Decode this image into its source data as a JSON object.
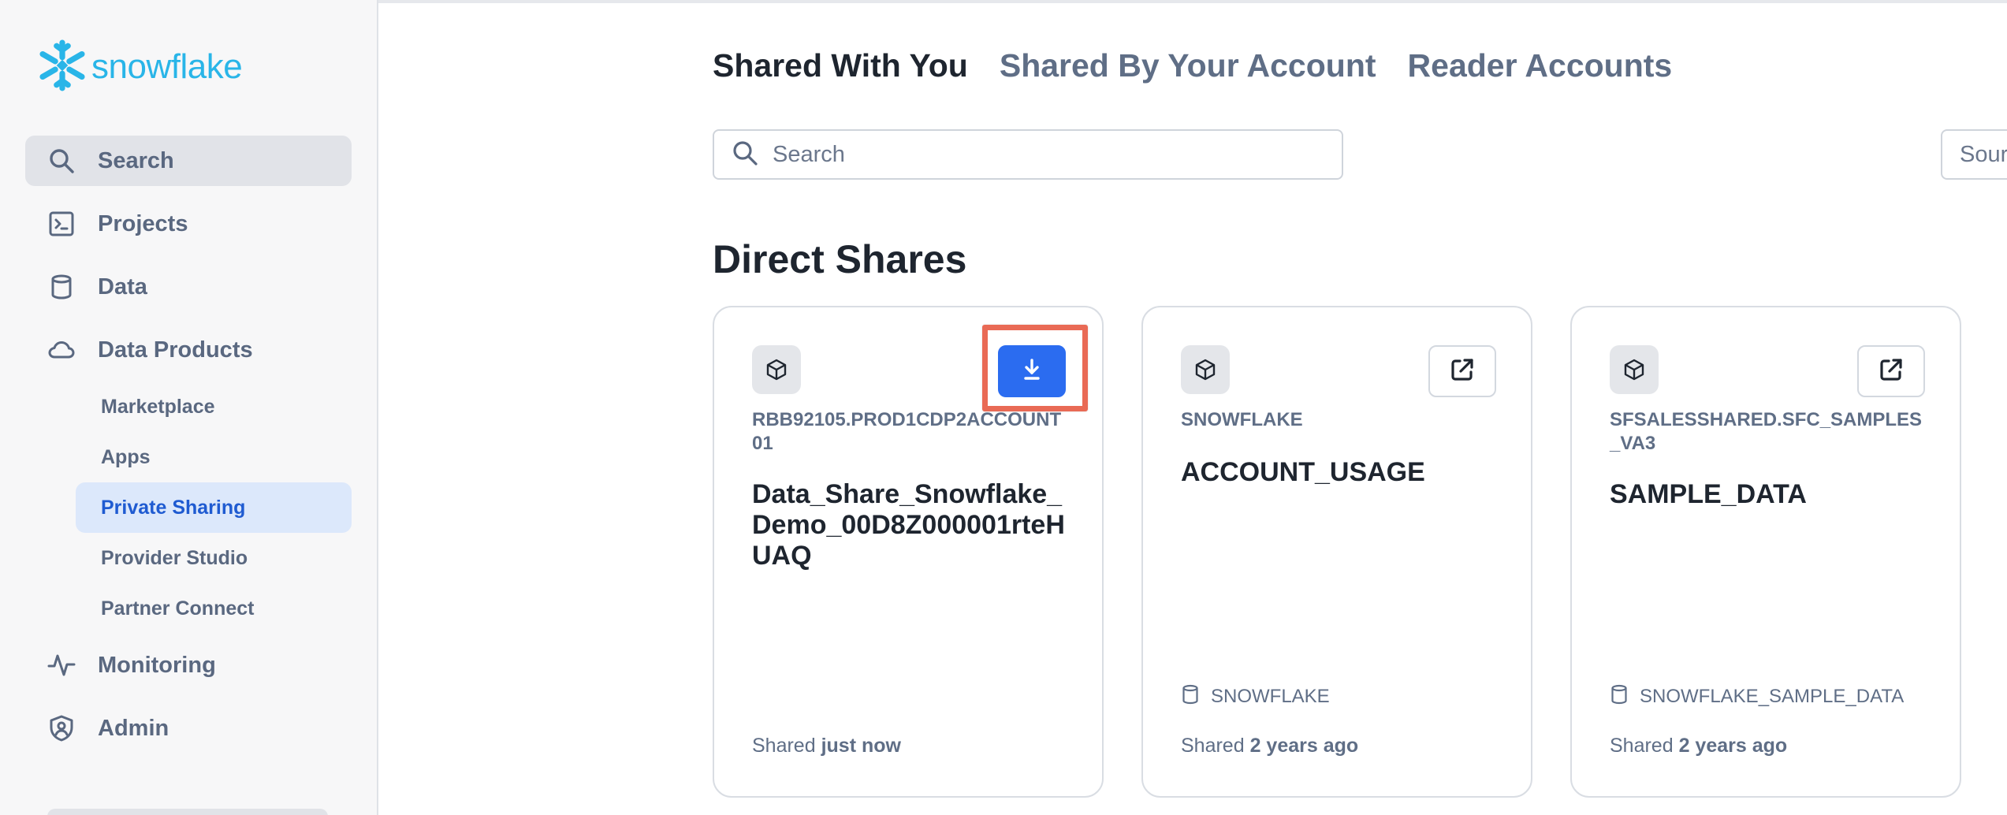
{
  "brand": {
    "logo_text": "snowflake",
    "logo_icon": "snowflake-icon",
    "accent": "#29b5e8"
  },
  "sidebar": {
    "nav": [
      {
        "label": "Search",
        "icon": "search-icon",
        "active": true
      },
      {
        "label": "Projects",
        "icon": "terminal-icon",
        "active": false
      },
      {
        "label": "Data",
        "icon": "database-icon",
        "active": false
      },
      {
        "label": "Data Products",
        "icon": "cloud-icon",
        "active": false
      },
      {
        "label": "Monitoring",
        "icon": "activity-icon",
        "active": false
      },
      {
        "label": "Admin",
        "icon": "shield-user-icon",
        "active": false
      }
    ],
    "data_products_sub": [
      {
        "label": "Marketplace",
        "selected": false
      },
      {
        "label": "Apps",
        "selected": false
      },
      {
        "label": "Private Sharing",
        "selected": true
      },
      {
        "label": "Provider Studio",
        "selected": false
      },
      {
        "label": "Partner Connect",
        "selected": false
      }
    ],
    "selected_color": "#1f5bd1"
  },
  "tabs": [
    {
      "label": "Shared With You",
      "active": true
    },
    {
      "label": "Shared By Your Account",
      "active": false
    },
    {
      "label": "Reader Accounts",
      "active": false
    }
  ],
  "search": {
    "placeholder": "Search",
    "value": ""
  },
  "source_filter": {
    "label": "Sour"
  },
  "section": {
    "title": "Direct Shares"
  },
  "cards": [
    {
      "provider": "RBB92105.PROD1CDP2ACCOUNT01",
      "name": "Data_Share_Snowflake_Demo_00D8Z000001rteHUAQ",
      "database": "",
      "shared_prefix": "Shared",
      "shared_when": "just now",
      "action_icon": "download-icon",
      "action_highlighted": true
    },
    {
      "provider": "SNOWFLAKE",
      "name": "ACCOUNT_USAGE",
      "database": "SNOWFLAKE",
      "shared_prefix": "Shared",
      "shared_when": "2 years ago",
      "action_icon": "external-link-icon",
      "action_highlighted": false
    },
    {
      "provider": "SFSALESSHARED.SFC_SAMPLES_VA3",
      "name": "SAMPLE_DATA",
      "database": "SNOWFLAKE_SAMPLE_DATA",
      "shared_prefix": "Shared",
      "shared_when": "2 years ago",
      "action_icon": "external-link-icon",
      "action_highlighted": false
    }
  ],
  "colors": {
    "primary_button": "#2b6cf0",
    "highlight_outline": "#e96a55"
  }
}
